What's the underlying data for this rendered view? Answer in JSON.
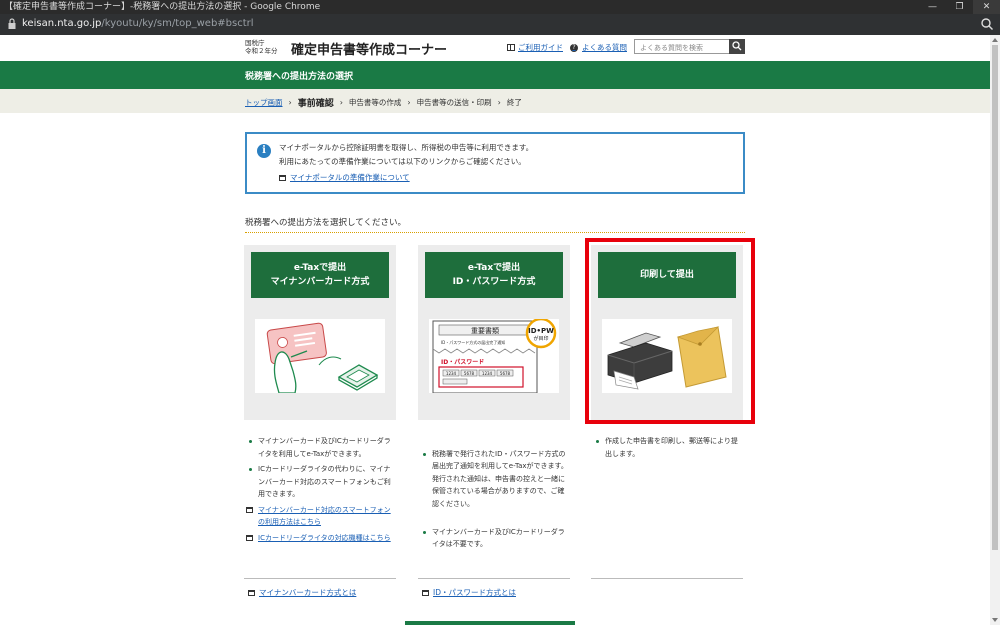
{
  "browser": {
    "window_title": "【確定申告書等作成コーナー】-税務署への提出方法の選択 - Google Chrome",
    "url_host": "keisan.nta.go.jp",
    "url_path": "/kyoutu/ky/sm/top_web#bsctrl"
  },
  "header": {
    "agency_line1": "国税庁",
    "agency_line2": "令和２年分",
    "site_title": "確定申告書等作成コーナー",
    "guide_link": "ご利用ガイド",
    "faq_link": "よくある質問",
    "search_placeholder": "よくある質問を検索"
  },
  "page_heading": "税務署への提出方法の選択",
  "breadcrumb": {
    "top": "トップ画面",
    "current": "事前確認",
    "step3": "申告書等の作成",
    "step4": "申告書等の送信・印刷",
    "step5": "終了"
  },
  "info": {
    "line1": "マイナポータルから控除証明書を取得し、所得税の申告等に利用できます。",
    "line2": "利用にあたっての準備作業については以下のリンクからご確認ください。",
    "link": "マイナポータルの準備作業について"
  },
  "prompt": "税務署への提出方法を選択してください。",
  "cards": [
    {
      "title_line1": "e-Taxで提出",
      "title_line2": "マイナンバーカード方式",
      "bullets": [
        "マイナンバーカード及びICカードリーダライタを利用してe-Taxができます。",
        "ICカードリーダライタの代わりに、マイナンバーカード対応のスマートフォンもご利用できます。"
      ],
      "links": [
        "マイナンバーカード対応のスマートフォンの利用方法はこちら",
        "ICカードリーダライタの対応機種はこちら"
      ],
      "bottom_link": "マイナンバーカード方式とは"
    },
    {
      "title_line1": "e-Taxで提出",
      "title_line2": "ID・パスワード方式",
      "badge_line1": "ID•PW",
      "badge_line2": "が目印",
      "doc_heading": "重要書類",
      "doc_sub": "ID・パスワード方式の届出完了通知",
      "doc_pw_label": "ID・パスワード",
      "doc_codes": [
        "1234",
        "5678",
        "1234",
        "5678"
      ],
      "bullets": [
        "税務署で発行されたID・パスワード方式の届出完了通知を利用してe-Taxができます。\n発行された通知は、申告書の控えと一緒に保管されている場合がありますので、ご確認ください。",
        "マイナンバーカード及びICカードリーダライタは不要です。"
      ],
      "bottom_link": "ID・パスワード方式とは"
    },
    {
      "title_line1": "印刷して提出",
      "bullets": [
        "作成した申告書を印刷し、郵送等により提出します。"
      ]
    }
  ],
  "colors": {
    "green": "#1a7a45",
    "card_green": "#1e6e3c",
    "selection_red": "#e8000b",
    "link_blue": "#1a5fb4",
    "info_border": "#3b8bc6"
  }
}
